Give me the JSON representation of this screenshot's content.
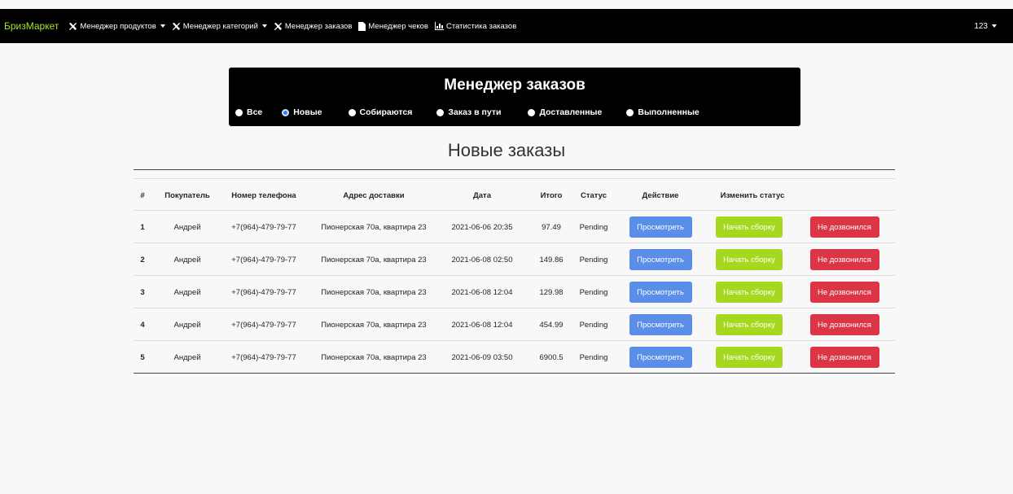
{
  "nav": {
    "brand": "БризМаркет",
    "items": [
      {
        "label": "Менеджер продуктов",
        "icon": "tools-icon",
        "dropdown": true
      },
      {
        "label": "Менеджер категорий",
        "icon": "tools-icon",
        "dropdown": true
      },
      {
        "label": "Менеджер заказов",
        "icon": "tools-icon",
        "dropdown": false
      },
      {
        "label": "Менеджер чеков",
        "icon": "document-icon",
        "dropdown": false
      },
      {
        "label": "Статистика заказов",
        "icon": "chart-icon",
        "dropdown": false
      }
    ],
    "user": "123"
  },
  "filter": {
    "title": "Менеджер заказов",
    "options": [
      {
        "label": "Все",
        "checked": false
      },
      {
        "label": "Новые",
        "checked": true
      },
      {
        "label": "Собираются",
        "checked": false
      },
      {
        "label": "Заказ в пути",
        "checked": false
      },
      {
        "label": "Доставленные",
        "checked": false
      },
      {
        "label": "Выполненные",
        "checked": false
      }
    ]
  },
  "page_heading": "Новые заказы",
  "table": {
    "headers": [
      "#",
      "Покупатель",
      "Номер телефона",
      "Адрес доставки",
      "Дата",
      "Итого",
      "Статус",
      "Действие",
      "Изменить статус"
    ],
    "rows": [
      {
        "num": "1",
        "customer": "Андрей",
        "phone": "+7(964)-479-79-77",
        "address": "Пионерская 70а, квартира 23",
        "date": "2021-06-06 20:35",
        "total": "97.49",
        "status": "Pending"
      },
      {
        "num": "2",
        "customer": "Андрей",
        "phone": "+7(964)-479-79-77",
        "address": "Пионерская 70а, квартира 23",
        "date": "2021-06-08 02:50",
        "total": "149.86",
        "status": "Pending"
      },
      {
        "num": "3",
        "customer": "Андрей",
        "phone": "+7(964)-479-79-77",
        "address": "Пионерская 70а, квартира 23",
        "date": "2021-06-08 12:04",
        "total": "129.98",
        "status": "Pending"
      },
      {
        "num": "4",
        "customer": "Андрей",
        "phone": "+7(964)-479-79-77",
        "address": "Пионерская 70а, квартира 23",
        "date": "2021-06-08 12:04",
        "total": "454.99",
        "status": "Pending"
      },
      {
        "num": "5",
        "customer": "Андрей",
        "phone": "+7(964)-479-79-77",
        "address": "Пионерская 70а, квартира 23",
        "date": "2021-06-09 03:50",
        "total": "6900.5",
        "status": "Pending"
      }
    ],
    "buttons": {
      "view": "Просмотреть",
      "start": "Начать сборку",
      "fail": "Не дозвонился"
    }
  },
  "colors": {
    "brand": "#a6e22e",
    "view_button": "#5b8ee8",
    "start_button": "#a6d81f",
    "fail_button": "#dc3545",
    "navbar": "#000000"
  }
}
